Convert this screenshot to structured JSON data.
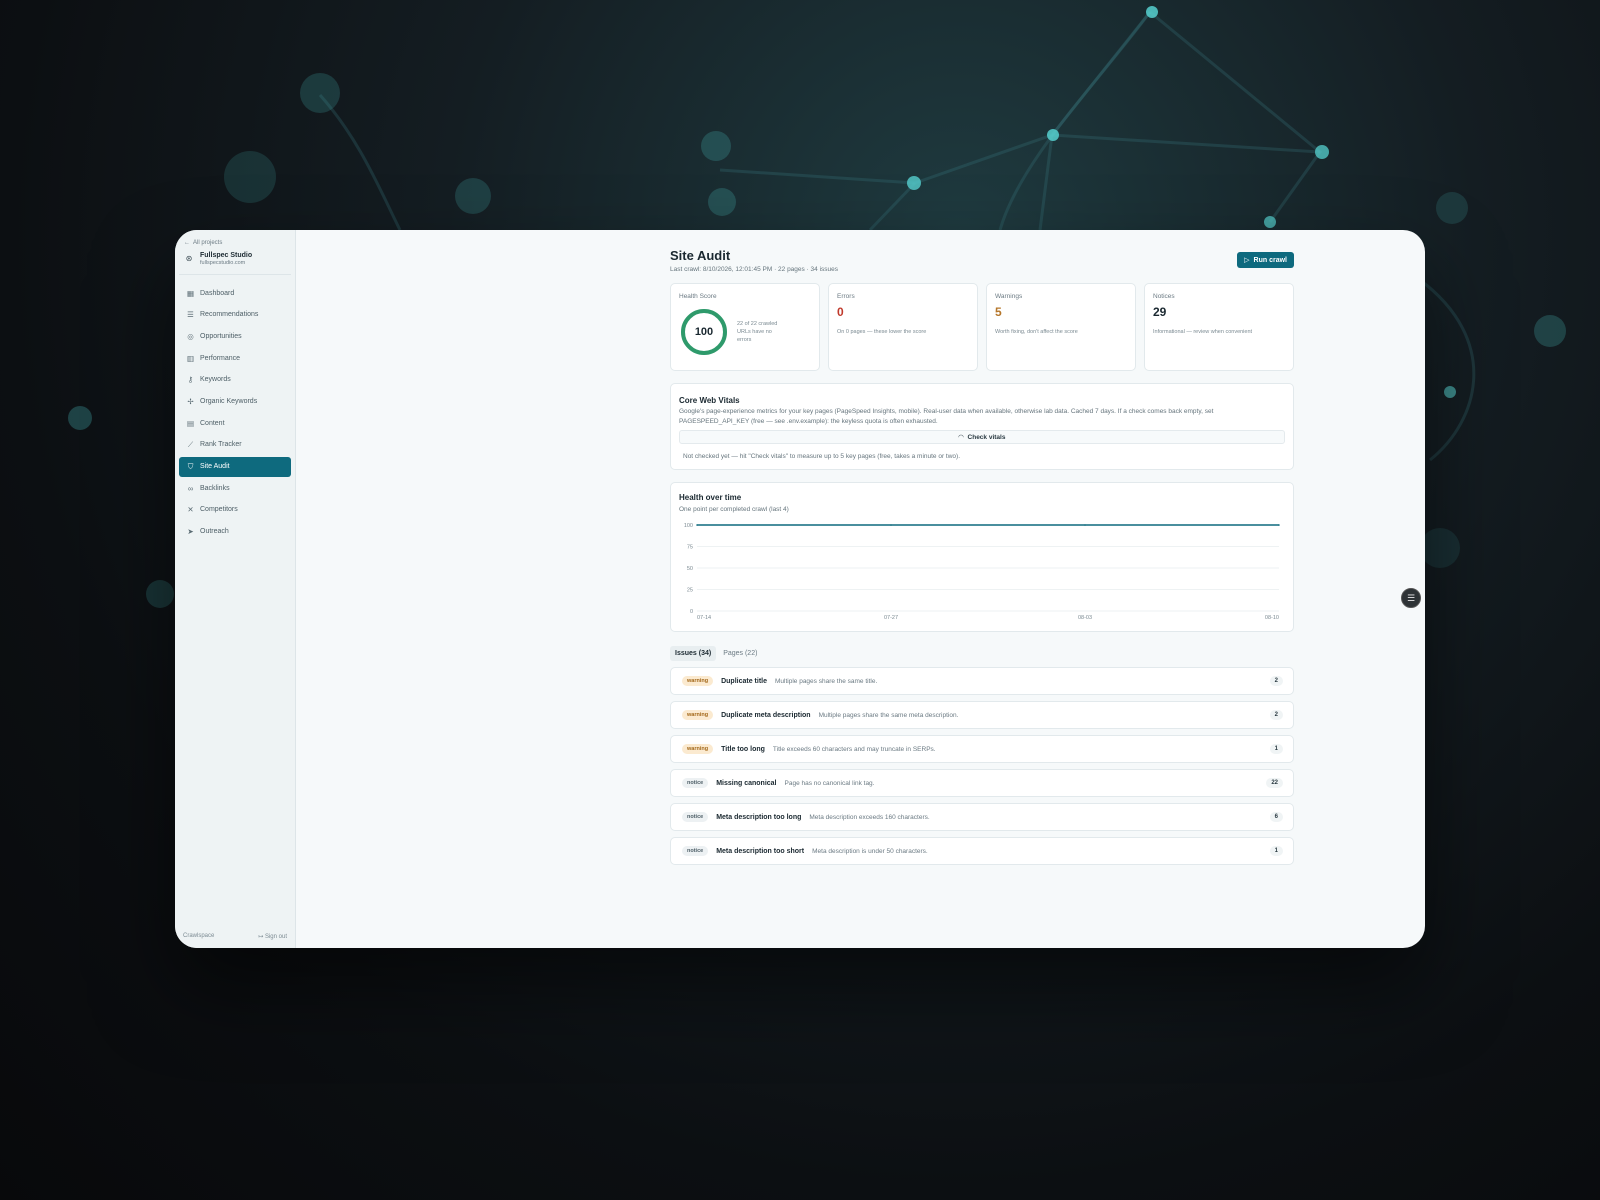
{
  "colors": {
    "accent": "#0e6a7e",
    "health_ring": "#2e9a6b",
    "errors": "#c0392b",
    "warnings": "#b5762a"
  },
  "sidebar": {
    "back_label": "All projects",
    "project_name": "Fullspec Studio",
    "project_url": "fullspecstudio.com",
    "items": [
      {
        "label": "Dashboard",
        "icon": "dashboard-icon"
      },
      {
        "label": "Recommendations",
        "icon": "list-check-icon"
      },
      {
        "label": "Opportunities",
        "icon": "target-icon"
      },
      {
        "label": "Performance",
        "icon": "bar-chart-icon"
      },
      {
        "label": "Keywords",
        "icon": "key-icon"
      },
      {
        "label": "Organic Keywords",
        "icon": "sprout-icon"
      },
      {
        "label": "Content",
        "icon": "document-icon"
      },
      {
        "label": "Rank Tracker",
        "icon": "line-chart-icon"
      },
      {
        "label": "Site Audit",
        "icon": "shield-check-icon",
        "active": true
      },
      {
        "label": "Backlinks",
        "icon": "link-icon"
      },
      {
        "label": "Competitors",
        "icon": "swords-icon"
      },
      {
        "label": "Outreach",
        "icon": "send-icon"
      }
    ],
    "footer_brand": "Crawlspace",
    "sign_out": "Sign out"
  },
  "header": {
    "title": "Site Audit",
    "subtitle": "Last crawl: 8/10/2026, 12:01:45 PM · 22 pages · 34 issues",
    "run_crawl": "Run crawl"
  },
  "stats": {
    "health": {
      "label": "Health Score",
      "value": "100",
      "score_fraction": 1.0,
      "desc": "22 of 22 crawled URLs have no errors"
    },
    "errors": {
      "label": "Errors",
      "value": "0",
      "desc": "On 0 pages — these lower the score"
    },
    "warnings": {
      "label": "Warnings",
      "value": "5",
      "desc": "Worth fixing, don't affect the score"
    },
    "notices": {
      "label": "Notices",
      "value": "29",
      "desc": "Informational — review when convenient"
    }
  },
  "core_web_vitals": {
    "title": "Core Web Vitals",
    "description": "Google's page-experience metrics for your key pages (PageSpeed Insights, mobile). Real-user data when available, otherwise lab data. Cached 7 days. If a check comes back empty, set PAGESPEED_API_KEY (free — see .env.example): the keyless quota is often exhausted.",
    "check_button": "Check vitals",
    "status": "Not checked yet — hit \"Check vitals\" to measure up to 5 key pages (free, takes a minute or two)."
  },
  "health_chart": {
    "title": "Health over time",
    "subtitle": "One point per completed crawl (last 4)"
  },
  "chart_data": {
    "type": "line",
    "title": "Health over time",
    "x": [
      "07-14",
      "07-27",
      "08-03",
      "08-10"
    ],
    "series": [
      {
        "values": [
          100,
          100,
          100,
          100
        ]
      }
    ],
    "ylim": [
      0,
      100
    ],
    "yticks": [
      "100",
      "75",
      "50",
      "25",
      "0"
    ],
    "grid": true,
    "color": "#0e6a7e"
  },
  "tabs": [
    {
      "label": "Issues (34)",
      "active": true
    },
    {
      "label": "Pages (22)"
    }
  ],
  "issues": [
    {
      "severity": "warning",
      "title": "Duplicate title",
      "desc": "Multiple pages share the same title.",
      "count": "2"
    },
    {
      "severity": "warning",
      "title": "Duplicate meta description",
      "desc": "Multiple pages share the same meta description.",
      "count": "2"
    },
    {
      "severity": "warning",
      "title": "Title too long",
      "desc": "Title exceeds 60 characters and may truncate in SERPs.",
      "count": "1"
    },
    {
      "severity": "notice",
      "title": "Missing canonical",
      "desc": "Page has no canonical link tag.",
      "count": "22"
    },
    {
      "severity": "notice",
      "title": "Meta description too long",
      "desc": "Meta description exceeds 160 characters.",
      "count": "6"
    },
    {
      "severity": "notice",
      "title": "Meta description too short",
      "desc": "Meta description is under 50 characters.",
      "count": "1"
    }
  ]
}
